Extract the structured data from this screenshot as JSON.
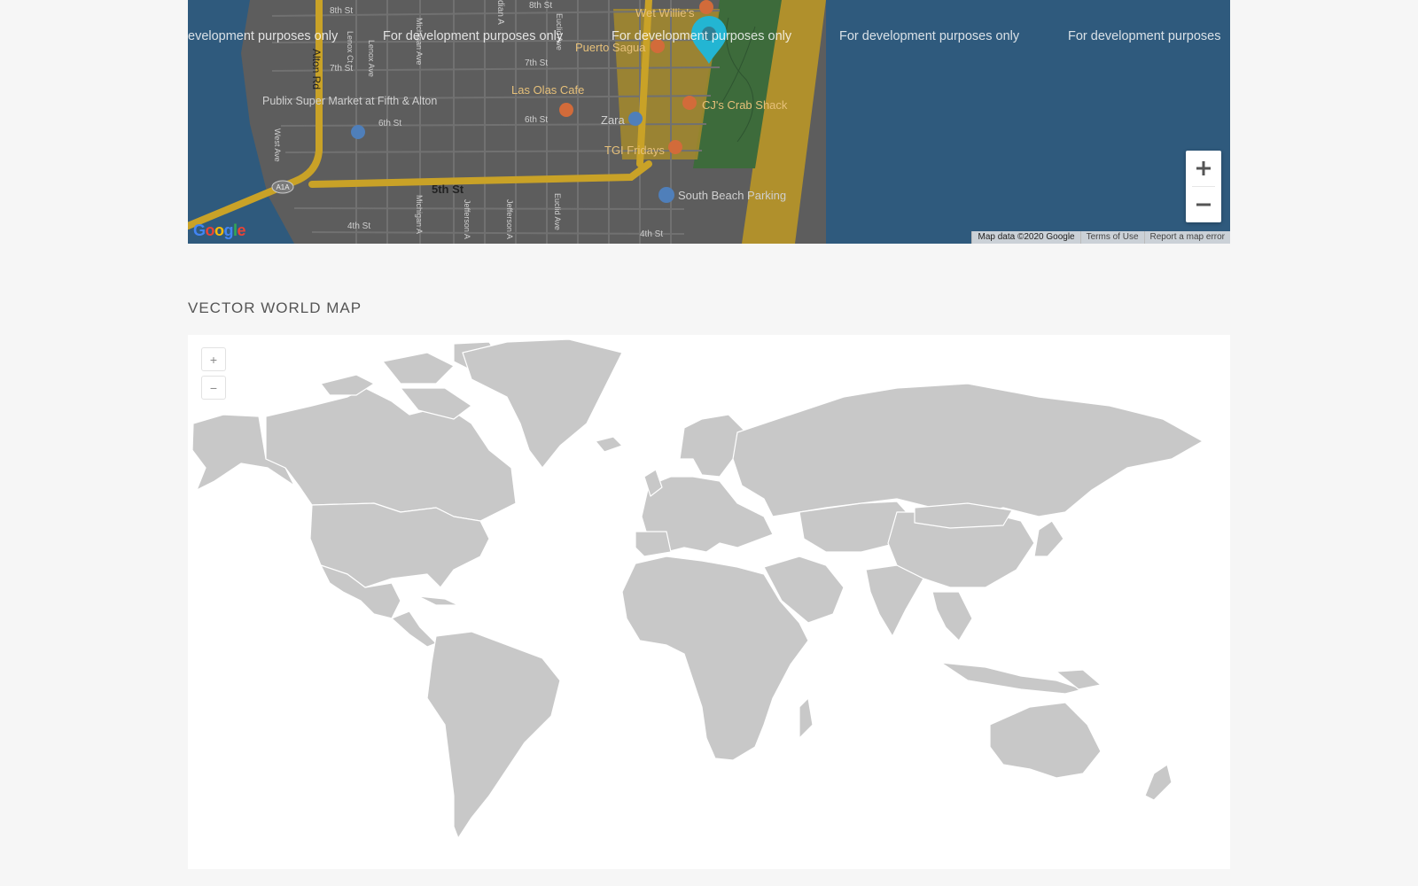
{
  "google_map": {
    "watermark": "For development purposes only",
    "watermarks": [
      "evelopment purposes only",
      "For development purposes only",
      "For development purposes only",
      "For development purposes only",
      "For development purposes"
    ],
    "streets": [
      "8th St",
      "8th St",
      "7th St",
      "7th St",
      "6th St",
      "6th St",
      "5th St",
      "4th St",
      "4th St",
      "Alton Rd",
      "Lenox Ct",
      "Lenox Ave",
      "Michigan Ave",
      "Jefferson A",
      "Euclid Ave",
      "West Ave",
      "Michigan A",
      "Jefferson A",
      "Euclid Ave",
      "dian A"
    ],
    "places": [
      "Wet Willie's",
      "Puerto Sagua",
      "Las Olas Cafe",
      "Publix Super Market at Fifth & Alton",
      "Zara",
      "CJ's Crab Shack",
      "TGI Fridays",
      "South Beach Parking"
    ],
    "road_shield": "A1A",
    "logo": "Google",
    "attribution": [
      "Map data ©2020 Google",
      "Terms of Use",
      "Report a map error"
    ],
    "zoom_in_label": "+",
    "zoom_out_label": "−",
    "colors": {
      "water": "#2f5a7d",
      "land": "#5e5e5e",
      "roads": "#c9a227",
      "park": "#3e6b3a",
      "pin": "#23b5d3"
    }
  },
  "vector_map": {
    "title": "VECTOR WORLD MAP",
    "zoom_in_label": "+",
    "zoom_out_label": "−",
    "colors": {
      "land": "#c8c8c8",
      "border": "#ffffff",
      "background": "#ffffff"
    }
  }
}
